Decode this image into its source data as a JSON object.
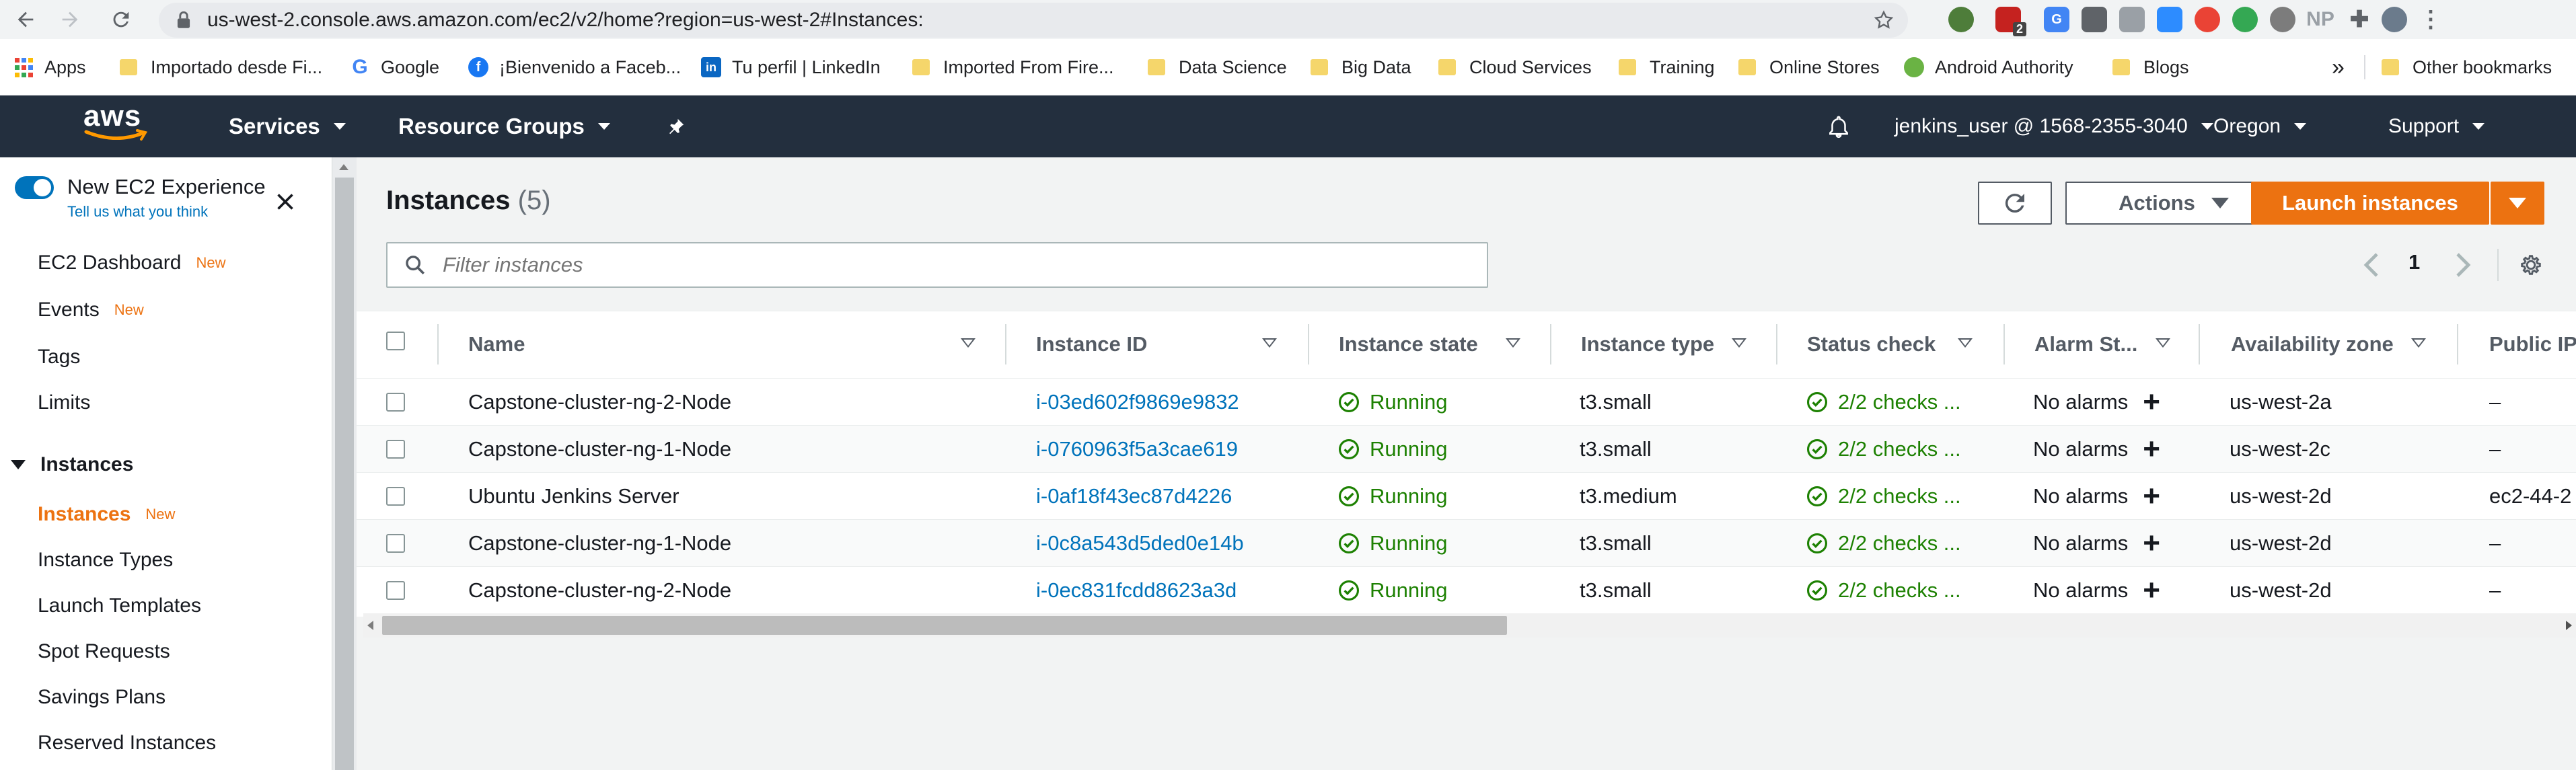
{
  "browser": {
    "url": "us-west-2.console.aws.amazon.com/ec2/v2/home?region=us-west-2#Instances:",
    "extension_badge": "2",
    "extension_np": "NP"
  },
  "bookmarks": {
    "apps": "Apps",
    "items": [
      "Importado desde Fi...",
      "Google",
      "¡Bienvenido a Faceb...",
      "Tu perfil | LinkedIn",
      "Imported From Fire...",
      "Data Science",
      "Big Data",
      "Cloud Services",
      "Training",
      "Online Stores",
      "Android Authority",
      "Blogs"
    ],
    "more": "»",
    "other": "Other bookmarks"
  },
  "aws_header": {
    "logo": "aws",
    "services": "Services",
    "resource_groups": "Resource Groups",
    "account": "jenkins_user @ 1568-2355-3040",
    "region": "Oregon",
    "support": "Support"
  },
  "sidebar": {
    "experience_title": "New EC2 Experience",
    "experience_link": "Tell us what you think",
    "new_tag": "New",
    "top_items": [
      {
        "label": "EC2 Dashboard",
        "new": true
      },
      {
        "label": "Events",
        "new": true
      },
      {
        "label": "Tags",
        "new": false
      },
      {
        "label": "Limits",
        "new": false
      }
    ],
    "section_title": "Instances",
    "section_items": [
      {
        "label": "Instances",
        "new": true,
        "active": true
      },
      {
        "label": "Instance Types"
      },
      {
        "label": "Launch Templates"
      },
      {
        "label": "Spot Requests"
      },
      {
        "label": "Savings Plans"
      },
      {
        "label": "Reserved Instances"
      }
    ]
  },
  "main": {
    "title": "Instances",
    "count": "(5)",
    "actions_label": "Actions",
    "launch_label": "Launch instances",
    "filter_placeholder": "Filter instances",
    "page_number": "1"
  },
  "table": {
    "headers": [
      "Name",
      "Instance ID",
      "Instance state",
      "Instance type",
      "Status check",
      "Alarm St...",
      "Availability zone",
      "Public IP"
    ],
    "rows": [
      {
        "name": "Capstone-cluster-ng-2-Node",
        "id": "i-03ed602f9869e9832",
        "state": "Running",
        "type": "t3.small",
        "status": "2/2 checks ...",
        "alarm": "No alarms",
        "az": "us-west-2a",
        "ip": "–"
      },
      {
        "name": "Capstone-cluster-ng-1-Node",
        "id": "i-0760963f5a3cae619",
        "state": "Running",
        "type": "t3.small",
        "status": "2/2 checks ...",
        "alarm": "No alarms",
        "az": "us-west-2c",
        "ip": "–"
      },
      {
        "name": "Ubuntu Jenkins Server",
        "id": "i-0af18f43ec87d4226",
        "state": "Running",
        "type": "t3.medium",
        "status": "2/2 checks ...",
        "alarm": "No alarms",
        "az": "us-west-2d",
        "ip": "ec2-44-2"
      },
      {
        "name": "Capstone-cluster-ng-1-Node",
        "id": "i-0c8a543d5ded0e14b",
        "state": "Running",
        "type": "t3.small",
        "status": "2/2 checks ...",
        "alarm": "No alarms",
        "az": "us-west-2d",
        "ip": "–"
      },
      {
        "name": "Capstone-cluster-ng-2-Node",
        "id": "i-0ec831fcdd8623a3d",
        "state": "Running",
        "type": "t3.small",
        "status": "2/2 checks ...",
        "alarm": "No alarms",
        "az": "us-west-2d",
        "ip": "–"
      }
    ]
  },
  "colors": {
    "aws_header": "#232f3e",
    "primary_orange": "#ec7211",
    "link_blue": "#0073bb",
    "running_green": "#1d8102"
  }
}
